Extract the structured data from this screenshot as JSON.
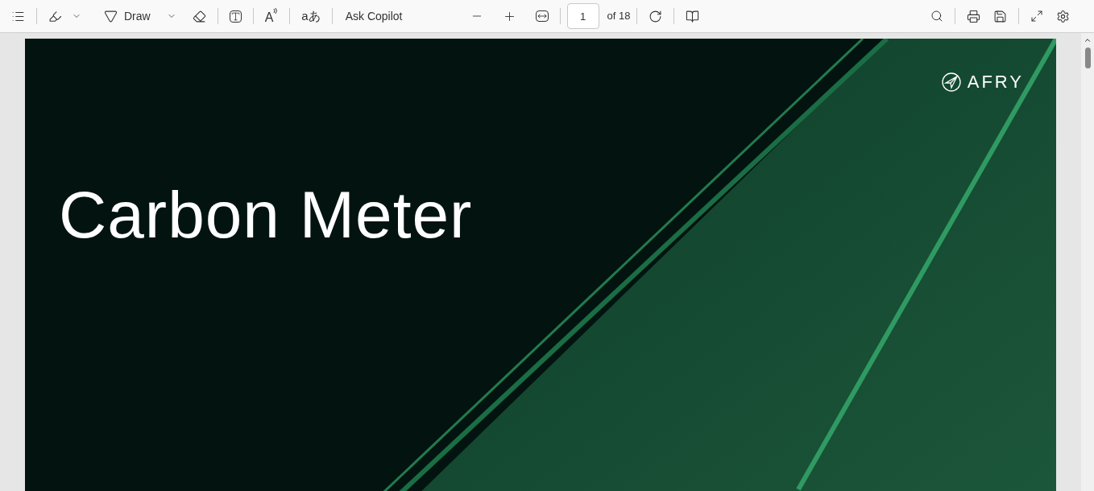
{
  "toolbar": {
    "draw_label": "Draw",
    "read_aloud_glyph": "A",
    "translate_glyph": "aあ",
    "copilot_label": "Ask Copilot",
    "page_number": "1",
    "page_count": "of 18"
  },
  "slide": {
    "title": "Carbon Meter",
    "logo_text": "AFRY"
  }
}
